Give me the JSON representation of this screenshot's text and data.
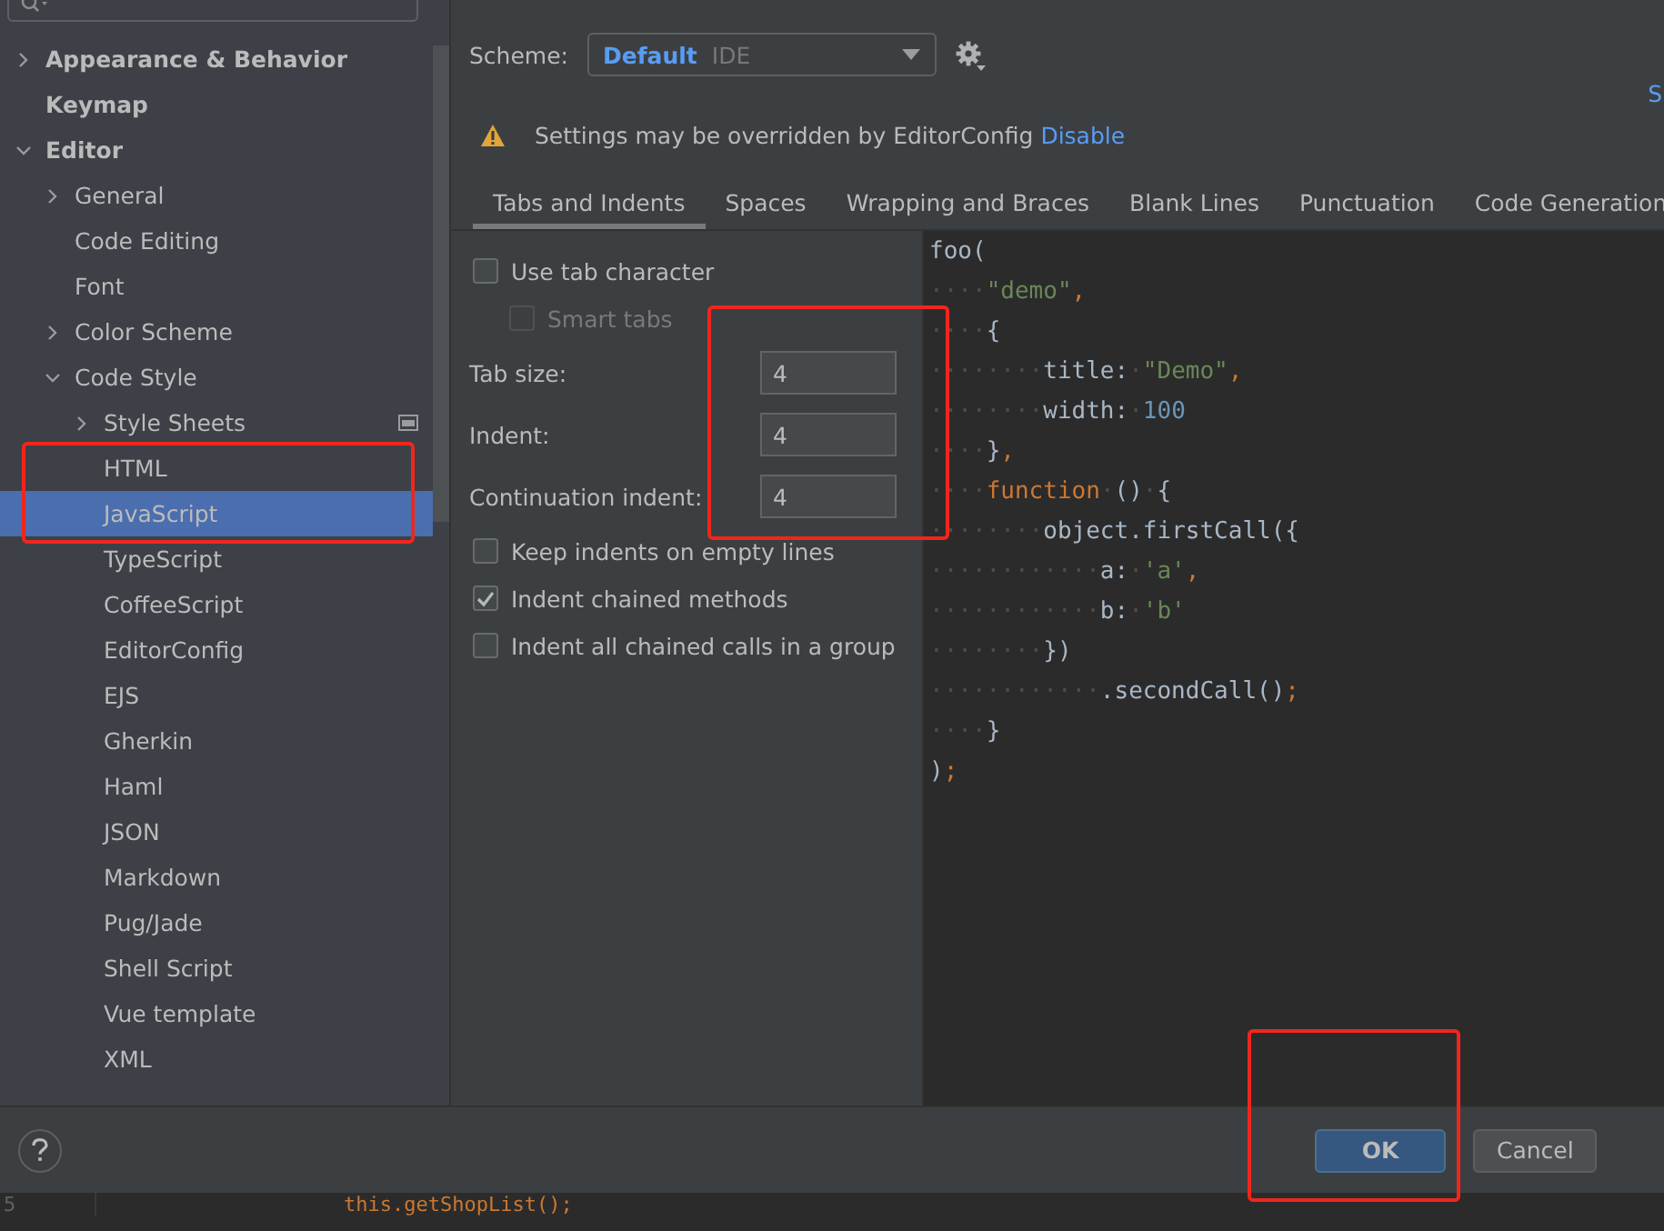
{
  "sidebar": {
    "items": [
      {
        "label": "Appearance & Behavior",
        "expanded": false,
        "selected": false
      },
      {
        "label": "Keymap",
        "selected": false
      },
      {
        "label": "Editor",
        "expanded": true,
        "selected": false,
        "children": [
          {
            "label": "General",
            "expanded": false,
            "selected": false
          },
          {
            "label": "Code Editing",
            "selected": false
          },
          {
            "label": "Font",
            "selected": false
          },
          {
            "label": "Color Scheme",
            "expanded": false,
            "selected": false
          },
          {
            "label": "Code Style",
            "expanded": true,
            "selected": false,
            "children": [
              {
                "label": "Style Sheets",
                "expanded": false,
                "selected": false,
                "project_icon": true
              },
              {
                "label": "HTML",
                "selected": false
              },
              {
                "label": "JavaScript",
                "selected": true
              },
              {
                "label": "TypeScript",
                "selected": false
              },
              {
                "label": "CoffeeScript",
                "selected": false
              },
              {
                "label": "EditorConfig",
                "selected": false
              },
              {
                "label": "EJS",
                "selected": false
              },
              {
                "label": "Gherkin",
                "selected": false
              },
              {
                "label": "Haml",
                "selected": false
              },
              {
                "label": "JSON",
                "selected": false
              },
              {
                "label": "Markdown",
                "selected": false
              },
              {
                "label": "Pug/Jade",
                "selected": false
              },
              {
                "label": "Shell Script",
                "selected": false
              },
              {
                "label": "Vue template",
                "selected": false
              },
              {
                "label": "XML",
                "selected": false
              }
            ]
          }
        ]
      }
    ]
  },
  "scheme": {
    "label": "Scheme:",
    "name": "Default",
    "type": "IDE"
  },
  "edge_link": "S",
  "notice": {
    "text": "Settings may be overridden by EditorConfig",
    "link": "Disable"
  },
  "tabs": [
    {
      "label": "Tabs and Indents",
      "selected": true
    },
    {
      "label": "Spaces",
      "selected": false
    },
    {
      "label": "Wrapping and Braces",
      "selected": false
    },
    {
      "label": "Blank Lines",
      "selected": false
    },
    {
      "label": "Punctuation",
      "selected": false
    },
    {
      "label": "Code Generation",
      "selected": false
    }
  ],
  "options": [
    {
      "kind": "checkbox",
      "label": "Use tab character",
      "checked": false,
      "disabled": false,
      "children": [
        {
          "kind": "checkbox",
          "label": "Smart tabs",
          "checked": false,
          "disabled": true
        }
      ]
    },
    {
      "kind": "number",
      "label": "Tab size:",
      "value": "4"
    },
    {
      "kind": "number",
      "label": "Indent:",
      "value": "4"
    },
    {
      "kind": "number",
      "label": "Continuation indent:",
      "value": "4"
    },
    {
      "kind": "checkbox",
      "label": "Keep indents on empty lines",
      "checked": false,
      "disabled": false
    },
    {
      "kind": "checkbox",
      "label": "Indent chained methods",
      "checked": true,
      "disabled": false
    },
    {
      "kind": "checkbox",
      "label": "Indent all chained calls in a group",
      "checked": false,
      "disabled": false
    }
  ],
  "preview": {
    "lines": [
      [
        {
          "kind": "plain",
          "text": "foo("
        }
      ],
      [
        {
          "kind": "ws",
          "text": "····"
        },
        {
          "kind": "string",
          "text": "\"demo\""
        },
        {
          "kind": "keyword",
          "text": ","
        }
      ],
      [
        {
          "kind": "ws",
          "text": "····"
        },
        {
          "kind": "plain",
          "text": "{"
        }
      ],
      [
        {
          "kind": "ws",
          "text": "········"
        },
        {
          "kind": "plain",
          "text": "title:"
        },
        {
          "kind": "ws",
          "text": "·"
        },
        {
          "kind": "string",
          "text": "\"Demo\""
        },
        {
          "kind": "keyword",
          "text": ","
        }
      ],
      [
        {
          "kind": "ws",
          "text": "········"
        },
        {
          "kind": "plain",
          "text": "width:"
        },
        {
          "kind": "ws",
          "text": "·"
        },
        {
          "kind": "number",
          "text": "100"
        }
      ],
      [
        {
          "kind": "ws",
          "text": "····"
        },
        {
          "kind": "plain",
          "text": "}"
        },
        {
          "kind": "keyword",
          "text": ","
        }
      ],
      [
        {
          "kind": "ws",
          "text": "····"
        },
        {
          "kind": "keyword",
          "text": "function"
        },
        {
          "kind": "ws",
          "text": "·"
        },
        {
          "kind": "plain",
          "text": "()"
        },
        {
          "kind": "ws",
          "text": "·"
        },
        {
          "kind": "plain",
          "text": "{"
        }
      ],
      [
        {
          "kind": "ws",
          "text": "········"
        },
        {
          "kind": "plain",
          "text": "object.firstCall({"
        }
      ],
      [
        {
          "kind": "ws",
          "text": "············"
        },
        {
          "kind": "plain",
          "text": "a:"
        },
        {
          "kind": "ws",
          "text": "·"
        },
        {
          "kind": "string",
          "text": "'a'"
        },
        {
          "kind": "keyword",
          "text": ","
        }
      ],
      [
        {
          "kind": "ws",
          "text": "············"
        },
        {
          "kind": "plain",
          "text": "b:"
        },
        {
          "kind": "ws",
          "text": "·"
        },
        {
          "kind": "string",
          "text": "'b'"
        }
      ],
      [
        {
          "kind": "ws",
          "text": "········"
        },
        {
          "kind": "plain",
          "text": "})"
        }
      ],
      [
        {
          "kind": "ws",
          "text": "············"
        },
        {
          "kind": "plain",
          "text": ".secondCall()"
        },
        {
          "kind": "keyword",
          "text": ";"
        }
      ],
      [
        {
          "kind": "ws",
          "text": "····"
        },
        {
          "kind": "plain",
          "text": "}"
        }
      ],
      [
        {
          "kind": "plain",
          "text": ")"
        },
        {
          "kind": "keyword",
          "text": ";"
        }
      ]
    ]
  },
  "buttons": [
    {
      "label": "OK",
      "default": true
    },
    {
      "label": "Cancel",
      "default": false
    }
  ],
  "background_editor": {
    "line_number": "5",
    "code": "this.getShopList();"
  }
}
